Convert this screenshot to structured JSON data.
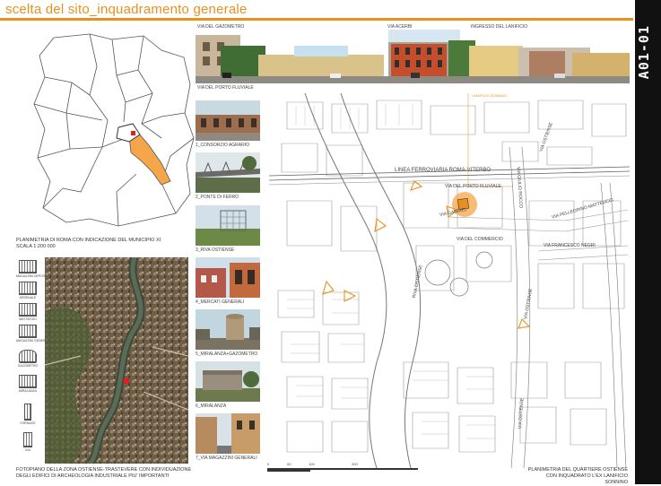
{
  "title": "scelta del sito_inquadramento generale",
  "sheet_code": "A01-01",
  "panorama": {
    "labels": [
      "VIA DEL GAZOMETRO",
      "VIA ACERBI",
      "INGRESSO DEL LANIFICIO"
    ],
    "bottom_label": "VIA DEL PORTO FLUVIALE"
  },
  "rome_map": {
    "caption_line1": "PLANIMETRIA DI ROMA CON INDICAZIONE DEL MUNICIPIO XI",
    "caption_line2": "SCALA 1:200 000"
  },
  "legend": [
    {
      "label": "MAGAZZINI DEPOSITI FRIGORIFERI"
    },
    {
      "label": "ARSENALE"
    },
    {
      "label": "MATTATOIO"
    },
    {
      "label": "MAGAZZINI GENERALI"
    },
    {
      "label": "GAZOMETRO"
    },
    {
      "label": "MIRALANZA"
    },
    {
      "label": "FORNACE"
    },
    {
      "label": "SAI"
    }
  ],
  "satellite_caption": {
    "line1": "FOTOPIANO DELLA ZONA OSTIENSE-TRASTEVERE CON INDIVIDUAZIONE",
    "line2": "DEGLI EDIFICI DI ARCHEOLOGIA INDUSTRIALE PIU' IMPORTANTI"
  },
  "photos": [
    {
      "label": "1_CONSORZIO AGRARIO"
    },
    {
      "label": "2_PONTE DI FERRO"
    },
    {
      "label": "3_RIVA OSTIENSE"
    },
    {
      "label": "4_MERCATI GENERALI"
    },
    {
      "label": "5_MIRALANZA+GAZOMETRO"
    },
    {
      "label": "6_MIRALANZA"
    },
    {
      "label": "7_VIA MAGAZZINI GENERALI"
    }
  ],
  "plan": {
    "streets": {
      "ferrovia": "LINEA FERROVIARIA ROMA-VITERBO",
      "porto": "VIA DEL PORTO FLUVIALE",
      "commercio": "VIA DEL COMMERCIO",
      "negri": "VIA FRANCESCO NEGRI",
      "matteucci": "VIA PELLEGRINO MATTEUCCI",
      "gabriel": "VIA DEL PORTO FLUVIALE",
      "ostiense": "VIA OSTIENSE",
      "riva": "RIVA OSTIENSE",
      "ostiense2": "VIA OSTIENSE",
      "enrico": "VIA GIULIO ROCCO",
      "gazometro2": "VIA GABRIEL",
      "hilite": "LANIFICIO SONNINO",
      "lower_ost": "VIA OSTIENSE"
    },
    "scale_labels": [
      "0",
      "50",
      "100",
      "200"
    ],
    "caption_line1": "PLANIMETRIA DEL QUARTIERE OSTIENSE",
    "caption_line2": "CON INQUADRATO L'EX LANIFICIO SONNINO"
  },
  "colors": {
    "accent": "#e8901e",
    "highlight": "#f5a54a"
  }
}
